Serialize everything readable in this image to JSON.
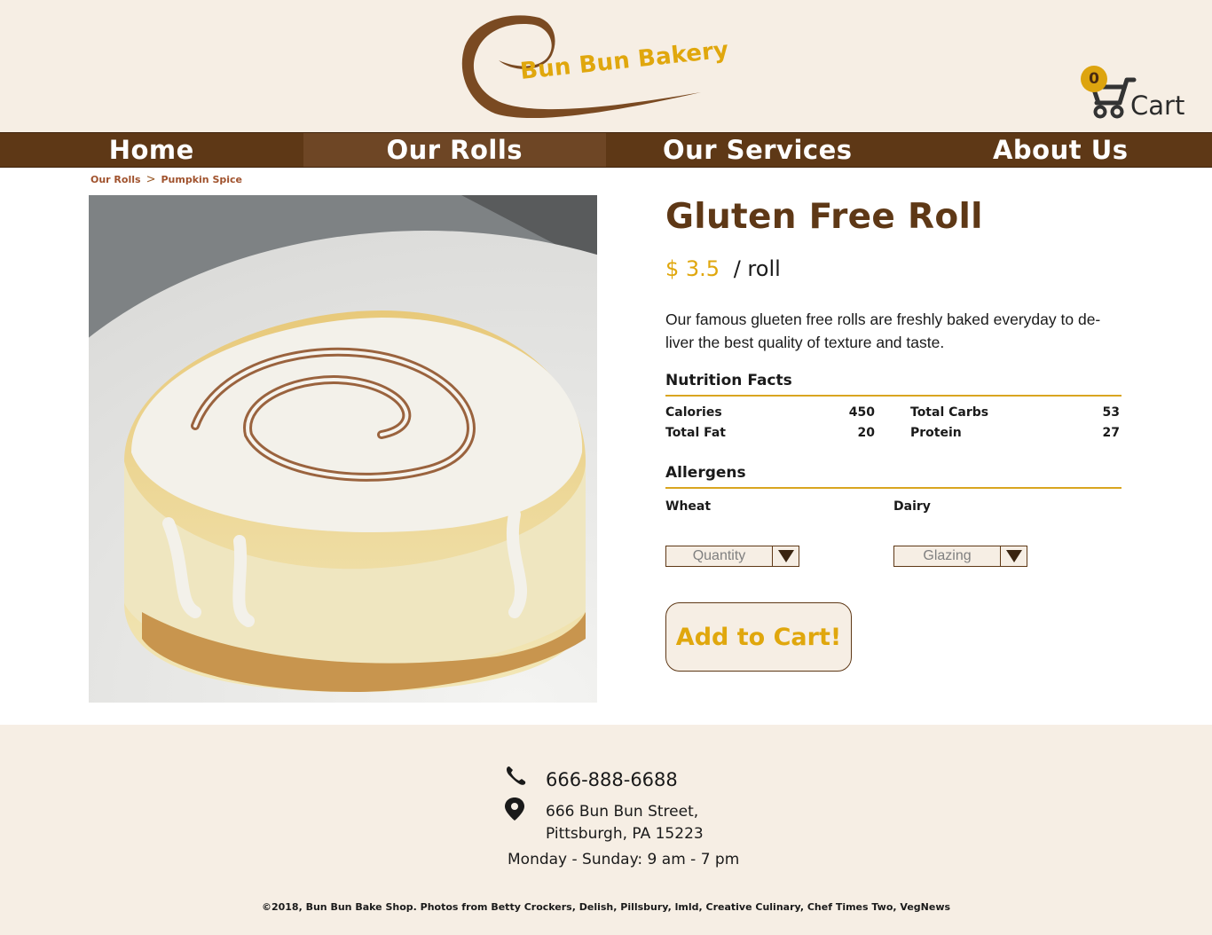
{
  "brand": {
    "name": "Bun Bun Bakery",
    "accent": "#e0a70d",
    "primary": "#5e3816",
    "background": "#f6eee4"
  },
  "cart": {
    "count": "0",
    "label": "Cart",
    "icon": "shopping-cart-icon"
  },
  "nav": {
    "items": [
      {
        "label": "Home"
      },
      {
        "label": "Our Rolls"
      },
      {
        "label": "Our Services"
      },
      {
        "label": "About Us"
      }
    ],
    "active": "Our Rolls"
  },
  "breadcrumb": {
    "items": [
      "Our Rolls",
      "Pumpkin Spice"
    ],
    "separator": ">"
  },
  "product": {
    "image": "cinnamon-roll-photo",
    "title": "Gluten Free Roll",
    "price": "$ 3.5",
    "unit": "/ roll",
    "description": "Our famous glueten free rolls are freshly baked everyday to de-liver the best quality of texture and taste.",
    "nutrition_title": "Nutrition Facts",
    "nutrition": {
      "calories_label": "Calories",
      "calories": "450",
      "carbs_label": "Total Carbs",
      "carbs": "53",
      "fat_label": "Total Fat",
      "fat": "20",
      "protein_label": "Protein",
      "protein": "27"
    },
    "allergens_title": "Allergens",
    "allergens": [
      "Wheat",
      "Dairy"
    ],
    "quantity_placeholder": "Quantity",
    "glazing_placeholder": "Glazing",
    "add_to_cart": "Add to Cart!"
  },
  "footer": {
    "phone": "666-888-6688",
    "address_line1": "666 Bun Bun Street,",
    "address_line2": "Pittsburgh, PA 15223",
    "hours": "Monday - Sunday: 9 am - 7 pm",
    "copyright": "©2018, Bun Bun Bake Shop. Photos from Betty Crockers, Delish, Pillsbury, lmld, Creative Culinary, Chef Times Two, VegNews"
  }
}
